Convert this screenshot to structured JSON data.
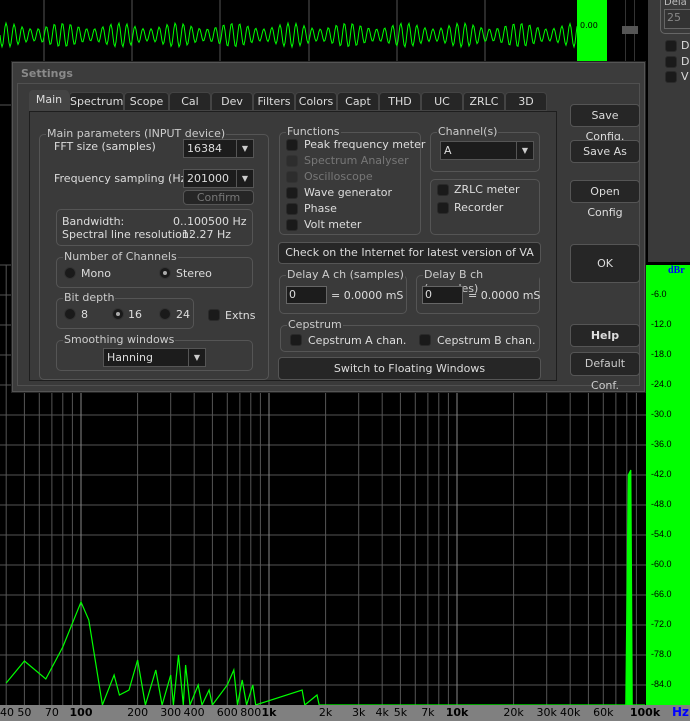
{
  "scope": {
    "level_label": "0.00",
    "trace_color": "#00ff00"
  },
  "right_panel": {
    "group_label": "Dela",
    "value": "25",
    "checks": [
      "D",
      "D",
      "V"
    ]
  },
  "dialog": {
    "title": "Settings",
    "tabs": [
      "Main",
      "Spectrum",
      "Scope",
      "Cal",
      "Dev",
      "Filters",
      "Colors",
      "Capt",
      "THD",
      "UC",
      "ZRLC",
      "3D"
    ],
    "active_tab": "Main",
    "main_params": {
      "label": "Main parameters (INPUT device)",
      "fft_label": "FFT size (samples)",
      "fft_value": "16384",
      "fs_label": "Frequency sampling (Hz)",
      "fs_value": "201000",
      "confirm": "Confirm",
      "bandwidth_label": "Bandwidth:",
      "bandwidth_value": "0..100500 Hz",
      "resolution_label": "Spectral line resolution:",
      "resolution_value": "12.27 Hz"
    },
    "channels": {
      "label": "Number of Channels",
      "mono": "Mono",
      "stereo": "Stereo",
      "selected": "Stereo"
    },
    "bitdepth": {
      "label": "Bit depth",
      "options": [
        "8",
        "16",
        "24"
      ],
      "selected": "16",
      "extns": "Extns"
    },
    "smoothing": {
      "label": "Smoothing windows",
      "value": "Hanning"
    },
    "functions": {
      "label": "Functions",
      "items": [
        {
          "label": "Peak frequency meter",
          "enabled": true
        },
        {
          "label": "Spectrum Analyser",
          "enabled": false
        },
        {
          "label": "Oscilloscope",
          "enabled": false
        },
        {
          "label": "Wave generator",
          "enabled": true
        },
        {
          "label": "Phase",
          "enabled": true
        },
        {
          "label": "Volt meter",
          "enabled": true
        }
      ]
    },
    "channel_sel": {
      "label": "Channel(s)",
      "value": "A"
    },
    "extra": {
      "zrlc": "ZRLC meter",
      "recorder": "Recorder"
    },
    "check_internet": "Check on the Internet for latest version of VA",
    "delay_a": {
      "label": "Delay A ch (samples)",
      "value": "0",
      "result": "= 0.0000 mS"
    },
    "delay_b": {
      "label": "Delay B ch (samples)",
      "value": "0",
      "result": "= 0.0000 mS"
    },
    "cepstrum": {
      "label": "Cepstrum",
      "a": "Cepstrum A chan.",
      "b": "Cepstrum B chan."
    },
    "switch_floating": "Switch to Floating Windows",
    "buttons": {
      "save_config": "Save Config.",
      "save_as": "Save As",
      "open_config": "Open Config",
      "ok": "OK",
      "help": "Help",
      "default_conf": "Default Conf."
    }
  },
  "spectrum": {
    "y_unit": "dBr",
    "x_unit": "Hz",
    "y_ticks": [
      "-6.0",
      "-12.0",
      "-18.0",
      "-24.0",
      "-30.0",
      "-36.0",
      "-42.0",
      "-48.0",
      "-54.0",
      "-60.0",
      "-66.0",
      "-72.0",
      "-78.0",
      "-84.0"
    ],
    "x_ticks": [
      {
        "f": 40,
        "t": "40"
      },
      {
        "f": 50,
        "t": "50"
      },
      {
        "f": 70,
        "t": "70"
      },
      {
        "f": 100,
        "t": "100",
        "b": true
      },
      {
        "f": 200,
        "t": "200"
      },
      {
        "f": 300,
        "t": "300"
      },
      {
        "f": 400,
        "t": "400"
      },
      {
        "f": 600,
        "t": "600"
      },
      {
        "f": 800,
        "t": "800"
      },
      {
        "f": 1000,
        "t": "1k",
        "b": true
      },
      {
        "f": 2000,
        "t": "2k"
      },
      {
        "f": 3000,
        "t": "3k"
      },
      {
        "f": 4000,
        "t": "4k"
      },
      {
        "f": 5000,
        "t": "5k"
      },
      {
        "f": 7000,
        "t": "7k"
      },
      {
        "f": 10000,
        "t": "10k",
        "b": true
      },
      {
        "f": 20000,
        "t": "20k"
      },
      {
        "f": 30000,
        "t": "30k"
      },
      {
        "f": 40000,
        "t": "40k"
      },
      {
        "f": 60000,
        "t": "60k"
      },
      {
        "f": 100000,
        "t": "100k",
        "b": true
      }
    ],
    "trace": [
      [
        40,
        -83.6
      ],
      [
        50,
        -79.2
      ],
      [
        65,
        -82.8
      ],
      [
        80,
        -76.4
      ],
      [
        100,
        -67.4
      ],
      [
        110,
        -71
      ],
      [
        130,
        -88
      ],
      [
        150,
        -82
      ],
      [
        160,
        -86
      ],
      [
        180,
        -85
      ],
      [
        200,
        -79
      ],
      [
        220,
        -88
      ],
      [
        250,
        -81
      ],
      [
        270,
        -88
      ],
      [
        300,
        -82
      ],
      [
        310,
        -88
      ],
      [
        330,
        -78
      ],
      [
        350,
        -88
      ],
      [
        360,
        -80
      ],
      [
        380,
        -88
      ],
      [
        420,
        -84
      ],
      [
        440,
        -88
      ],
      [
        480,
        -85
      ],
      [
        500,
        -88
      ],
      [
        600,
        -84
      ],
      [
        650,
        -81
      ],
      [
        680,
        -88
      ],
      [
        720,
        -83
      ],
      [
        760,
        -88
      ],
      [
        820,
        -84
      ],
      [
        850,
        -88
      ],
      [
        1500,
        -85
      ],
      [
        1550,
        -88
      ],
      [
        1800,
        -86
      ],
      [
        1850,
        -88
      ],
      [
        79000,
        -88
      ],
      [
        79500,
        -79
      ],
      [
        81500,
        -42
      ],
      [
        84000,
        -41
      ],
      [
        85000,
        -70
      ],
      [
        85500,
        -88
      ],
      [
        100000,
        -88
      ]
    ]
  }
}
